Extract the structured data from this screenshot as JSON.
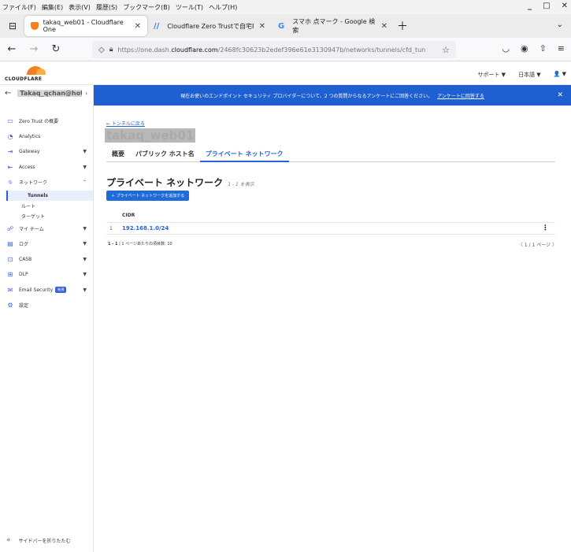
{
  "menubar": {
    "items": [
      "ファイル(F)",
      "編集(E)",
      "表示(V)",
      "履歴(S)",
      "ブックマーク(B)",
      "ツール(T)",
      "ヘルプ(H)"
    ]
  },
  "browser": {
    "tabs": [
      {
        "title": "takaq_web01 - Cloudflare One",
        "favicon": "cloudflare-shield-icon",
        "color": "#f6821f"
      },
      {
        "title": "Cloudflare Zero Trustで自宅PC",
        "favicon": "slash-logo-icon",
        "color": "#2b7de9"
      },
      {
        "title": "スマホ 点マーク - Google 検索",
        "favicon": "google-icon",
        "color": "#4285f4"
      }
    ],
    "url_prefix": "https://one.dash.",
    "url_domain": "cloudflare.com",
    "url_suffix": "/2468fc30623b2edef396e61e3130947b/networks/tunnels/cfd_tunnel/b12bb"
  },
  "header": {
    "logo_text": "CLOUDFLARE",
    "support": "サポート ▼",
    "language": "日本語 ▼",
    "user": "👤 ▼"
  },
  "sidebar": {
    "account": "Takaq_qchan@hot...",
    "items": [
      {
        "label": "Zero Trust の概要",
        "icon": "overview-icon"
      },
      {
        "label": "Analytics",
        "icon": "analytics-icon"
      },
      {
        "label": "Gateway",
        "icon": "gateway-icon"
      },
      {
        "label": "Access",
        "icon": "access-icon"
      },
      {
        "label": "ネットワーク",
        "icon": "network-icon"
      },
      {
        "label": "マイ チーム",
        "icon": "team-icon"
      },
      {
        "label": "ログ",
        "icon": "log-icon"
      },
      {
        "label": "CASB",
        "icon": "casb-icon"
      },
      {
        "label": "DLP",
        "icon": "dlp-icon"
      },
      {
        "label": "Email Security",
        "icon": "email-icon",
        "badge": "新規"
      },
      {
        "label": "設定",
        "icon": "settings-icon"
      }
    ],
    "sub_items": [
      "Tunnels",
      "ルート",
      "ターゲット"
    ],
    "collapse": "サイドバーを折りたたむ"
  },
  "banner": {
    "text": "現在お使いのエンドポイント セキュリティ プロバイダーについて、2 つの質問からなるアンケートにご回答ください。",
    "link": "アンケートに回答する"
  },
  "main": {
    "back": "← トンネルに戻る",
    "title": "takaq_web01",
    "tabs": [
      "概要",
      "パブリック ホスト名",
      "プライベート ネットワーク"
    ],
    "section_title": "プライベート ネットワーク",
    "section_count": "1 - 1 を表示",
    "add_button": "＋ プライベート ネットワークを追加する",
    "column_header": "CIDR",
    "rows": [
      {
        "index": "1",
        "cidr": "192.168.1.0/24"
      }
    ],
    "footer_range": "1 - 1",
    "footer_per_page": "1 ページあたりの項目数: 10",
    "pager": "〈 1 / 1 ページ 〉"
  }
}
